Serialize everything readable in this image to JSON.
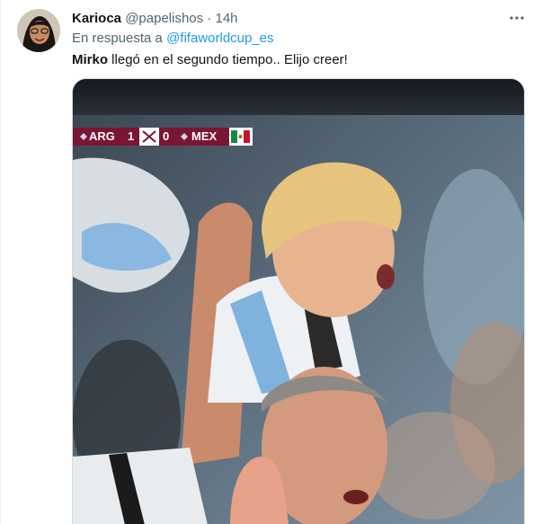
{
  "tweet": {
    "author_name": "Karioca",
    "author_handle": "@papelishos",
    "separator": "·",
    "timestamp": "14h",
    "reply_prefix": "En respuesta a",
    "reply_mention": "@fifaworldcup_es",
    "text_bold": "Mirko",
    "text_rest": " llegó en el segundo tiempo.. Elijo creer!"
  },
  "media": {
    "scorebug": {
      "team_home": "ARG",
      "score_home": "1",
      "score_away": "0",
      "team_away": "MEX"
    }
  },
  "icons": {
    "more": "more-options-icon",
    "avatar": "avatar-image"
  },
  "colors": {
    "link": "#1d9bf0",
    "secondary_text": "#536471",
    "scorebug_bg": "#7a1533"
  }
}
